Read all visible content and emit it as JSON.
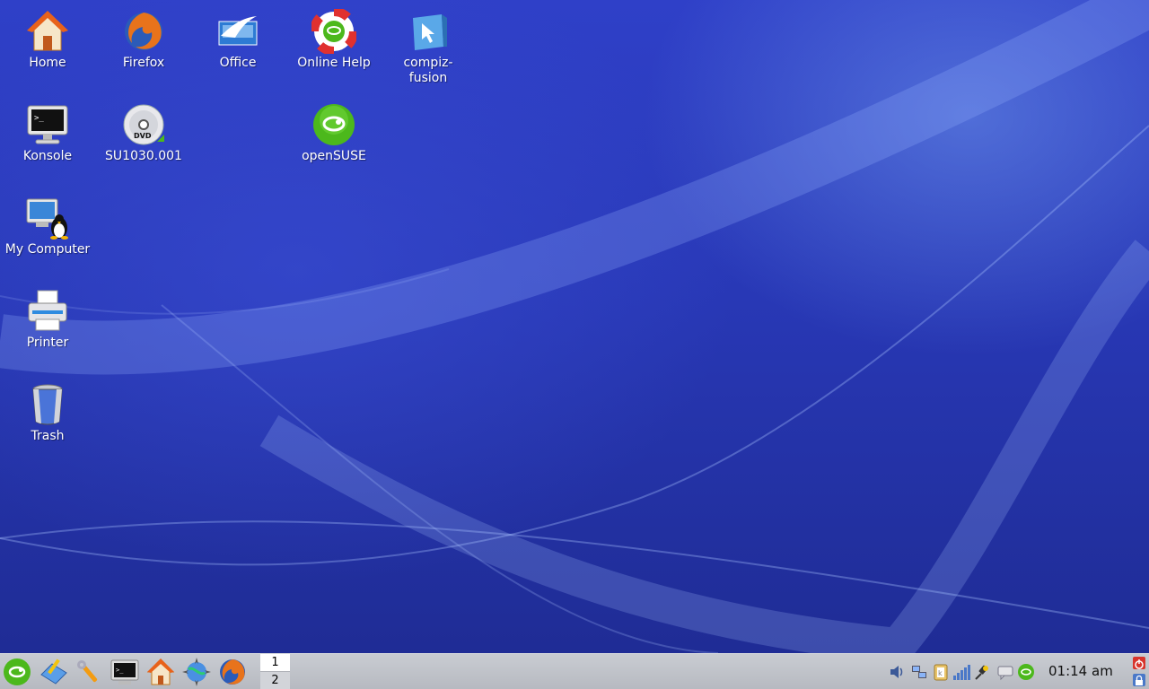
{
  "desktop": {
    "icons": [
      {
        "label": "Home",
        "icon": "home-folder-icon"
      },
      {
        "label": "Firefox",
        "icon": "firefox-icon"
      },
      {
        "label": "Office",
        "icon": "office-icon"
      },
      {
        "label": "Online Help",
        "icon": "lifebuoy-help-icon"
      },
      {
        "label": "compiz-fusion",
        "icon": "compiz-cube-icon"
      },
      {
        "label": "Konsole",
        "icon": "terminal-monitor-icon"
      },
      {
        "label": "SU1030.001",
        "icon": "dvd-icon"
      },
      {
        "label": "openSUSE",
        "icon": "opensuse-logo-icon"
      },
      {
        "label": "My Computer",
        "icon": "computer-tux-icon"
      },
      {
        "label": "Printer",
        "icon": "printer-icon"
      },
      {
        "label": "Trash",
        "icon": "trash-icon"
      }
    ]
  },
  "taskbar": {
    "launchers": [
      "opensuse-menu-icon",
      "office-writer-icon",
      "wrench-icon",
      "terminal-icon",
      "home-icon",
      "kmail-globe-icon",
      "firefox-icon"
    ],
    "pager": {
      "desktops": [
        "1",
        "2"
      ],
      "active": "1"
    },
    "tray": [
      "speaker-icon",
      "network-manager-icon",
      "klipper-icon",
      "signal-bars-icon",
      "power-plug-icon",
      "chat-icon",
      "opensuse-updater-icon"
    ],
    "clock": "01:14 am",
    "side_buttons": [
      "logout-icon",
      "lock-icon"
    ]
  },
  "colors": {
    "desktop_top": "#2f40c8",
    "desktop_bottom": "#1f2c95",
    "taskbar": "#c0c3c9",
    "opensuse_green": "#4cb81c"
  }
}
